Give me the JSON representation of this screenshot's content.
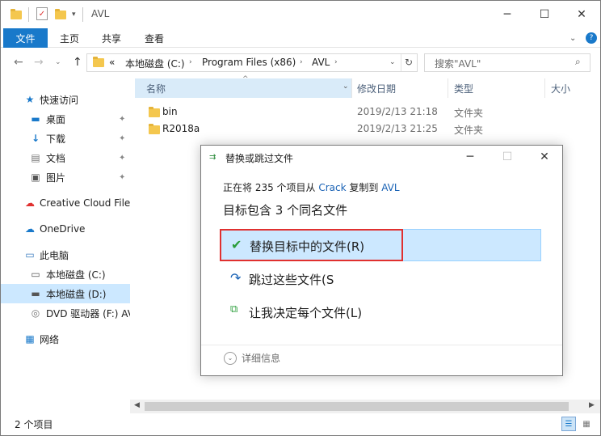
{
  "window": {
    "title": "AVL",
    "minimize": "─",
    "maximize": "☐",
    "close": "✕"
  },
  "ribbon": {
    "file_tab": "文件",
    "tabs": [
      "主页",
      "共享",
      "查看"
    ]
  },
  "address": {
    "prefix": "«",
    "crumbs": [
      "本地磁盘 (C:)",
      "Program Files (x86)",
      "AVL"
    ],
    "search_placeholder": "搜索\"AVL\""
  },
  "sidebar": {
    "items": [
      {
        "label": "快速访问",
        "icon": "star-icon"
      },
      {
        "label": "桌面",
        "icon": "desktop-icon",
        "pinned": true
      },
      {
        "label": "下载",
        "icon": "download-icon",
        "pinned": true
      },
      {
        "label": "文档",
        "icon": "document-icon",
        "pinned": true
      },
      {
        "label": "图片",
        "icon": "picture-icon",
        "pinned": true
      },
      {
        "label": "Creative Cloud Files",
        "icon": "creative-cloud-icon"
      },
      {
        "label": "OneDrive",
        "icon": "onedrive-icon"
      },
      {
        "label": "此电脑",
        "icon": "this-pc-icon"
      },
      {
        "label": "本地磁盘 (C:)",
        "icon": "drive-c-icon"
      },
      {
        "label": "本地磁盘 (D:)",
        "icon": "drive-d-icon",
        "selected": true
      },
      {
        "label": "DVD 驱动器 (F:) AVL",
        "icon": "dvd-icon"
      },
      {
        "label": "网络",
        "icon": "network-icon"
      }
    ]
  },
  "columns": {
    "name": "名称",
    "date": "修改日期",
    "type": "类型",
    "size": "大小"
  },
  "files": [
    {
      "name": "bin",
      "date": "2019/2/13 21:18",
      "type": "文件夹"
    },
    {
      "name": "R2018a",
      "date": "2019/2/13 21:25",
      "type": "文件夹"
    }
  ],
  "status": {
    "count": "2 个项目"
  },
  "dialog": {
    "title": "替换或跳过文件",
    "status_prefix": "正在将 235 个项目从 ",
    "source": "Crack",
    "status_middle": " 复制到 ",
    "destination": "AVL",
    "heading": "目标包含 3 个同名文件",
    "options": [
      {
        "label": "替换目标中的文件(R)",
        "icon": "checkmark-icon"
      },
      {
        "label": "跳过这些文件(S)",
        "icon": "skip-arrow-icon"
      },
      {
        "label": "让我决定每个文件(L)",
        "icon": "decide-files-icon"
      }
    ],
    "more_info": "详细信息"
  }
}
